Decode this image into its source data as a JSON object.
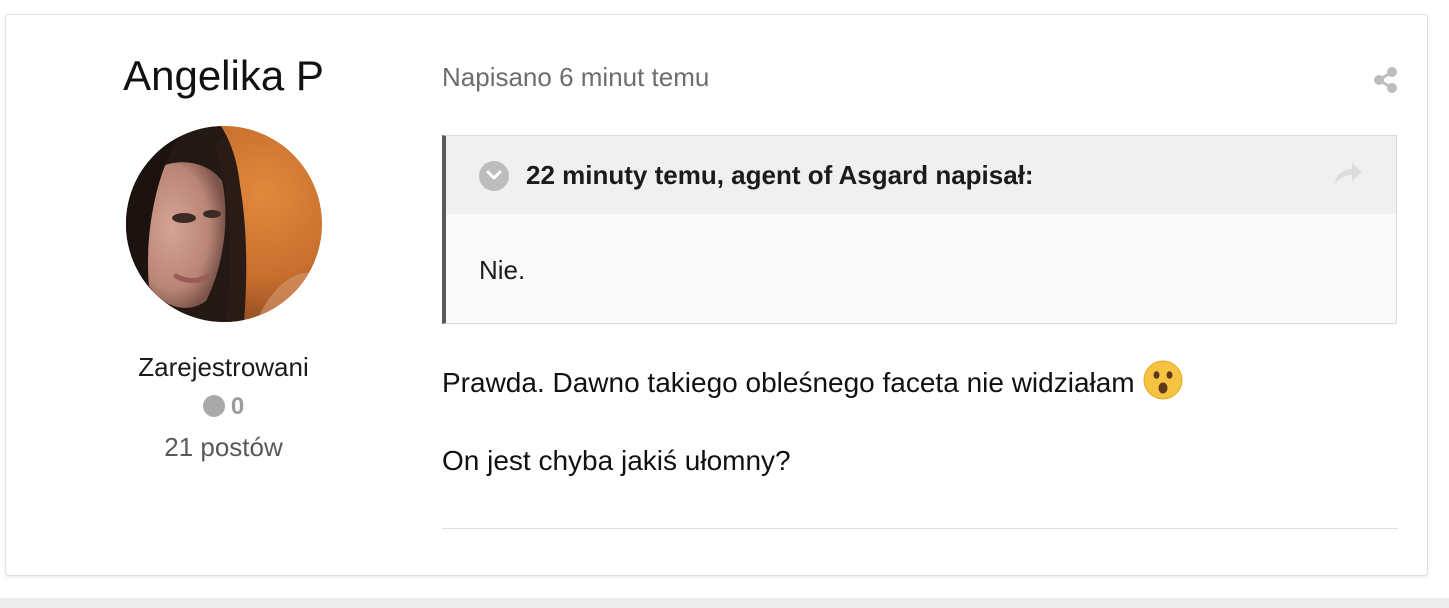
{
  "author": {
    "name": "Angelika P",
    "group": "Zarejestrowani",
    "reputation": "0",
    "post_count": "21 postów"
  },
  "post": {
    "meta": "Napisano 6 minut temu",
    "quote": {
      "citation": "22 minuty temu, agent of Asgard napisał:",
      "body": "Nie."
    },
    "lines": [
      "Prawda. Dawno takiego obleśnego faceta nie widziałam",
      "On jest chyba jakiś ułomny?"
    ],
    "emoji_icon": "surprised-face-icon"
  },
  "icons": {
    "share": "share-icon",
    "quote_toggle": "chevron-down-circle-icon",
    "quote_jump": "forward-arrow-icon"
  },
  "colors": {
    "quote_border": "#5a5a5a",
    "meta_text": "#6d6d6d",
    "emoji": "#f5c242"
  }
}
